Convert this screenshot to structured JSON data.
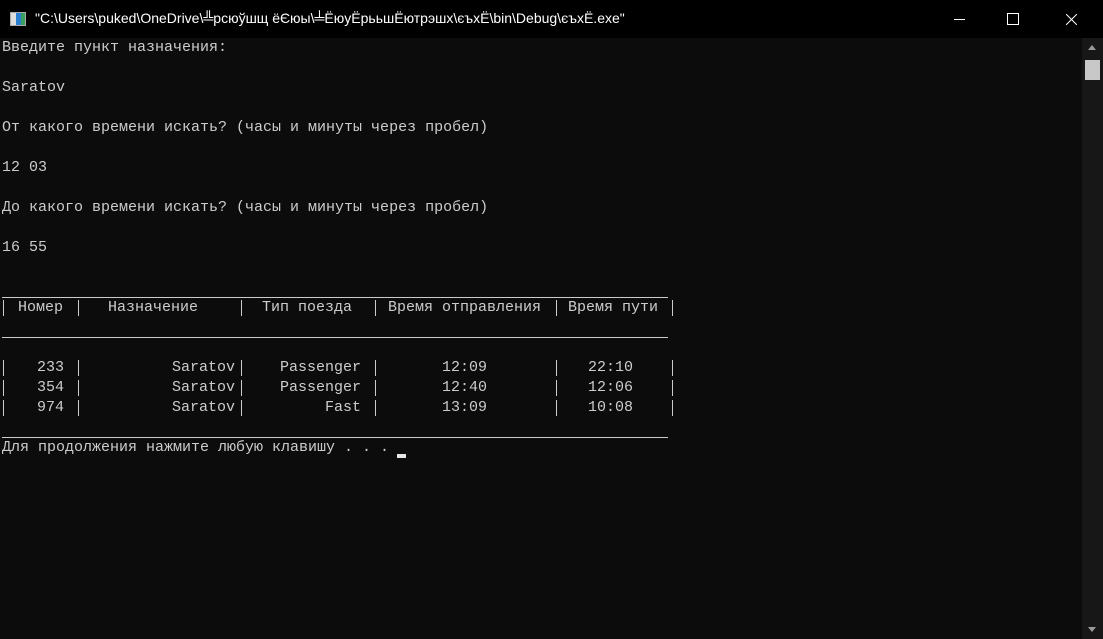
{
  "window": {
    "title": "\"C:\\Users\\puked\\OneDrive\\╩рсюўшщ ёЄюы\\╧ЁюуЁрььшЁютрэшх\\єъхЁ\\bin\\Debug\\єъхЁ.exe\""
  },
  "console": {
    "prompt_destination": "Введите пункт назначения:",
    "input_destination": "Saratov",
    "prompt_from": "От какого времени искать? (часы и минуты через пробел)",
    "input_from": "12 03",
    "prompt_to": "До какого времени искать? (часы и минуты через пробел)",
    "input_to": "16 55",
    "footer": "Для продолжения нажмите любую клавишу . . ."
  },
  "table": {
    "headers": [
      "Номер",
      "Назначение",
      "Тип поезда",
      "Время отправления",
      "Время пути"
    ],
    "rows": [
      [
        "233",
        "Saratov",
        "Passenger",
        "12:09",
        "22:10"
      ],
      [
        "354",
        "Saratov",
        "Passenger",
        "12:40",
        "12:06"
      ],
      [
        "974",
        "Saratov",
        "Fast",
        "13:09",
        "10:08"
      ]
    ]
  }
}
